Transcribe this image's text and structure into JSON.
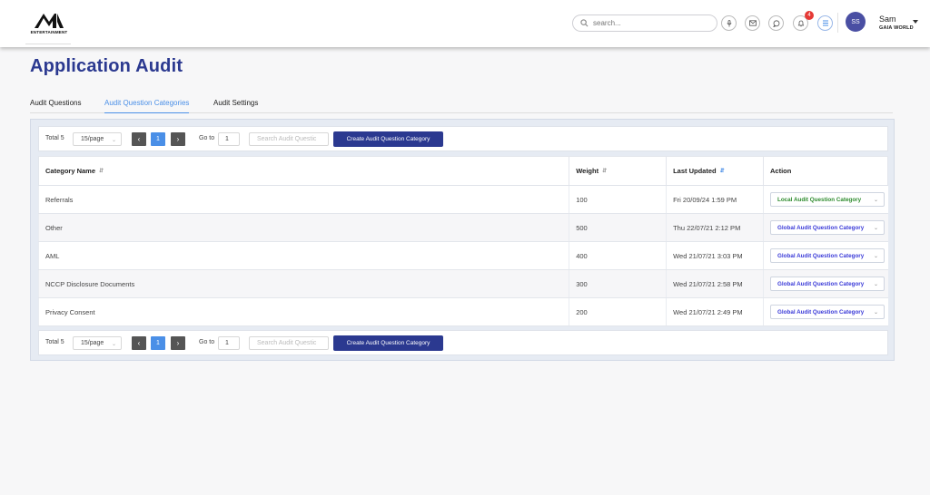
{
  "header": {
    "logo_text": "ENTERTAINMENT",
    "search_placeholder": "search...",
    "notification_count": "4",
    "avatar_initials": "SS",
    "user_name": "Sam",
    "user_org": "GAIA WORLD",
    "icons": [
      "mic-icon",
      "mail-icon",
      "chat-icon",
      "bell-icon",
      "menu-icon"
    ]
  },
  "page": {
    "title": "Application Audit",
    "tabs": [
      {
        "label": "Audit Questions",
        "active": false
      },
      {
        "label": "Audit Question Categories",
        "active": true
      },
      {
        "label": "Audit Settings",
        "active": false
      }
    ]
  },
  "pager": {
    "total": "Total 5",
    "page_size": "15/page",
    "current_page": "1",
    "goto_label": "Go to",
    "goto_value": "1",
    "search_placeholder": "Search Audit Questic",
    "create_label": "Create Audit Question Category"
  },
  "table": {
    "columns": [
      "Category Name",
      "Weight",
      "Last Updated",
      "Action"
    ],
    "rows": [
      {
        "name": "Referrals",
        "weight": "100",
        "updated": "Fri 20/09/24 1:59 PM",
        "action": "Local Audit Question Category",
        "scope": "local"
      },
      {
        "name": "Other",
        "weight": "500",
        "updated": "Thu 22/07/21 2:12 PM",
        "action": "Global Audit Question Category",
        "scope": "global"
      },
      {
        "name": "AML",
        "weight": "400",
        "updated": "Wed 21/07/21 3:03 PM",
        "action": "Global Audit Question Category",
        "scope": "global"
      },
      {
        "name": "NCCP Disclosure Documents",
        "weight": "300",
        "updated": "Wed 21/07/21 2:58 PM",
        "action": "Global Audit Question Category",
        "scope": "global"
      },
      {
        "name": "Privacy Consent",
        "weight": "200",
        "updated": "Wed 21/07/21 2:49 PM",
        "action": "Global Audit Question Category",
        "scope": "global"
      }
    ]
  },
  "colors": {
    "brand": "#2b3990",
    "accent": "#4a8fe7",
    "local": "#2e8b2e",
    "global": "#3b3bd8",
    "badge": "#e53935"
  }
}
